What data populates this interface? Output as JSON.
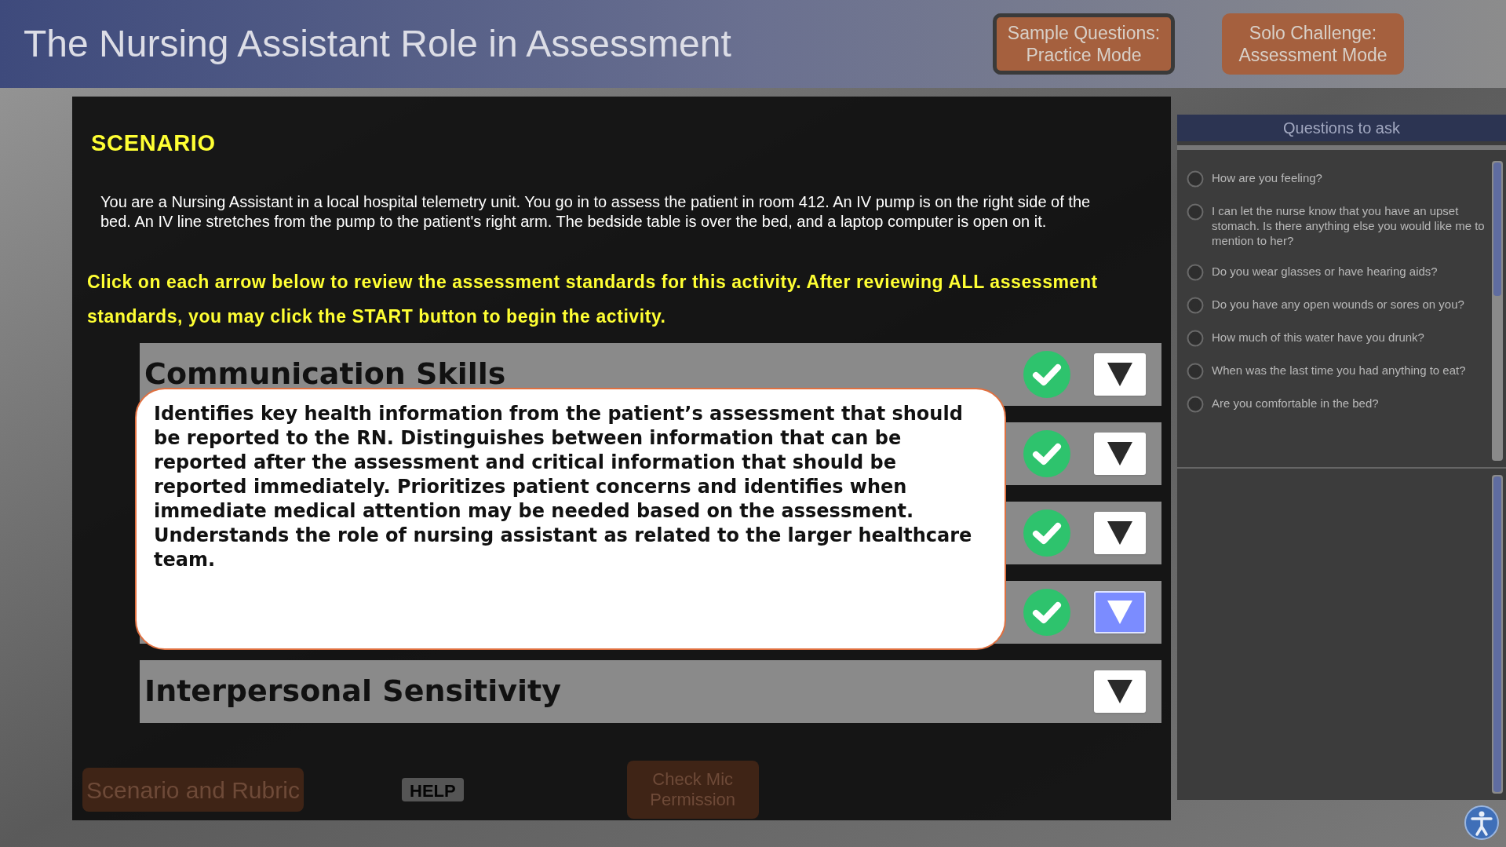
{
  "header": {
    "title": "The Nursing Assistant Role in Assessment"
  },
  "mode_buttons": [
    {
      "lines": [
        "Sample Questions:",
        "Practice Mode"
      ],
      "selected": true
    },
    {
      "lines": [
        "Solo Challenge:",
        "Assessment Mode"
      ],
      "selected": false
    }
  ],
  "scenario": {
    "heading": "SCENARIO",
    "text": "You are a Nursing Assistant in a local hospital telemetry unit. You go in to assess the patient in room 412. An IV pump is on the right side of the bed. An IV line stretches from the pump to the patient's right arm. The bedside table is over the bed, and a laptop computer is open on it.",
    "instructions": "Click on each arrow below to review the assessment standards for this activity. After reviewing ALL assessment standards, you may click the START button to begin the activity."
  },
  "standards": [
    {
      "title": "Communication Skills",
      "completed": true,
      "selected": false
    },
    {
      "completed": true,
      "selected": false
    },
    {
      "completed": true,
      "selected": false
    },
    {
      "completed": true,
      "selected": true
    },
    {
      "title": "Interpersonal Sensitivity",
      "completed": false,
      "selected": false
    }
  ],
  "popup": {
    "text": "Identifies key health information from the patient’s assessment that should be reported to the RN. Distinguishes between information that can be reported after the assessment and critical information that should be reported immediately. Prioritizes patient concerns and identifies when immediate medical attention may be needed based on the assessment. Understands the role of nursing assistant as related to the larger healthcare team."
  },
  "bottom_buttons": [
    {
      "kind": "primary",
      "label": "Scenario and Rubric"
    },
    {
      "kind": "help",
      "label": "HELP"
    },
    {
      "kind": "primary",
      "label": "Check Mic Permission"
    }
  ],
  "questions_panel": {
    "title": "Questions to ask",
    "questions": [
      {
        "text": "How are you feeling?",
        "selected": false
      },
      {
        "text": "I can let the nurse know that you have an upset stomach. Is there anything else you would like me to mention to her?",
        "selected": false
      },
      {
        "text": "Do you wear glasses or have hearing aids?",
        "selected": false
      },
      {
        "text": "Do you have any open wounds or sores on you?",
        "selected": false
      },
      {
        "text": "How much of this water have you drunk?",
        "selected": false
      },
      {
        "text": "When was the last time you had anything to eat?",
        "selected": false
      },
      {
        "text": "Are you comfortable in the bed?",
        "selected": false
      }
    ]
  }
}
